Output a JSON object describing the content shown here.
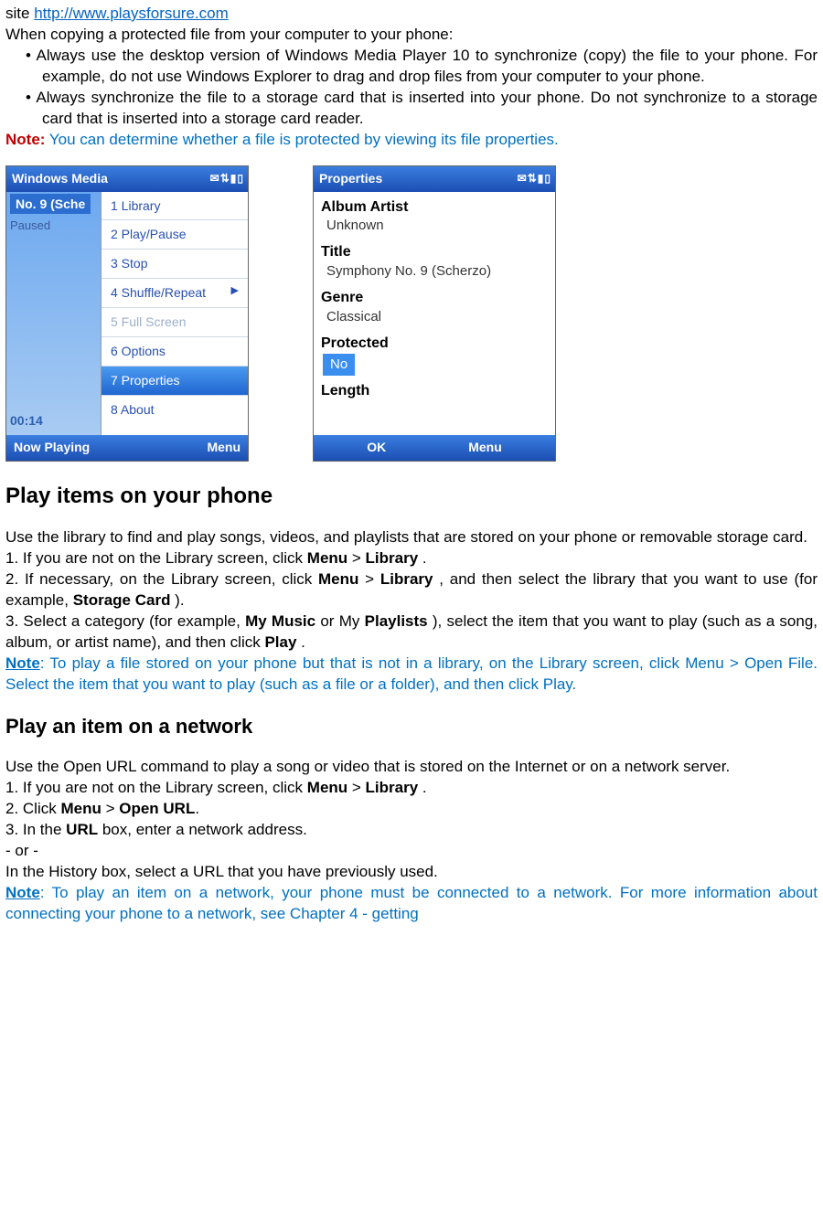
{
  "intro": {
    "site_prefix": "site ",
    "site_url": "http://www.playsforsure.com",
    "copy_heading": "When copying a protected file from your computer to your phone:",
    "bullet1": "• Always use the desktop version of Windows Media Player 10 to synchronize (copy) the file to your phone. For example, do not use Windows Explorer to drag and drop files from your computer to your phone.",
    "bullet2": "• Always synchronize the file to a storage card that is inserted into your phone. Do not synchronize to a storage card that is inserted into a storage card reader.",
    "note_label": "Note:",
    "note_text": " You can determine whether a file is protected by viewing its file properties."
  },
  "phone1": {
    "title": "Windows Media",
    "status_icons": "✉⇅▮▯",
    "track": "No. 9 (Sche",
    "status": "Paused",
    "time": "00:14",
    "menu": {
      "m1": "1 Library",
      "m2": "2 Play/Pause",
      "m3": "3 Stop",
      "m4": "4 Shuffle/Repeat",
      "m5": "5 Full Screen",
      "m6": "6 Options",
      "m7": "7 Properties",
      "m8": "8 About",
      "arrow": "▶"
    },
    "soft_left": "Now Playing",
    "soft_right": "Menu"
  },
  "phone2": {
    "title": "Properties",
    "status_icons": "✉⇅▮▯",
    "labels": {
      "album_artist": "Album Artist",
      "title": "Title",
      "genre": "Genre",
      "protected": "Protected",
      "length": "Length"
    },
    "values": {
      "album_artist": "Unknown",
      "title": "Symphony No. 9 (Scherzo)",
      "genre": "Classical",
      "protected": "No"
    },
    "soft_left": "OK",
    "soft_right": "Menu"
  },
  "section_play_items": {
    "heading": "Play items on your phone",
    "para_intro": "Use the library to find and play songs, videos, and playlists that are stored on your phone or removable storage card.",
    "step1_a": "1. If you are not on the Library screen, click ",
    "step1_menu": "Menu",
    "step1_gt": " > ",
    "step1_library": "Library",
    "step1_end": " .",
    "step2_a": "2. If necessary, on the Library screen, click ",
    "step2_menu": "Menu",
    "step2_gt": " > ",
    "step2_library": "Library",
    "step2_b": " , and then select the library that you want to use (for example, ",
    "step2_storage": "Storage Card",
    "step2_end": " ).",
    "step3_a": "3. Select a category (for example, ",
    "step3_mymusic": "My Music",
    "step3_b": " or My ",
    "step3_playlists": "Playlists",
    "step3_c": " ), select the item that you want to play (such as a song, album, or artist name), and then click ",
    "step3_play": "Play",
    "step3_end": " .",
    "note_label": "Note",
    "note_text": ": To play a file stored on your phone but that is not in a library, on the Library screen, click Menu > Open File. Select the item that you want to play (such as a file or a folder), and then click Play."
  },
  "section_network": {
    "heading": "Play an item on a network",
    "para_intro": "Use the Open URL command to play a song or video that is stored on the Internet or on a network server.",
    "step1_a": "1. If you are not on the Library screen, click ",
    "step1_menu": "Menu",
    "step1_gt": " > ",
    "step1_library": "Library",
    "step1_end": " .",
    "step2_a": "2. Click ",
    "step2_menu": "Menu",
    "step2_gt": " > ",
    "step2_openurl": "Open URL",
    "step2_end": ".",
    "step3_a": "3. In the ",
    "step3_url": "URL",
    "step3_b": " box, enter a network address.",
    "or": "- or -",
    "history": "In the History box, select a URL that you have previously used.",
    "note_label": "Note",
    "note_text": ": To play an item on a network, your phone must be connected to a network. For more information about connecting your phone to a network, see Chapter 4 - getting"
  }
}
